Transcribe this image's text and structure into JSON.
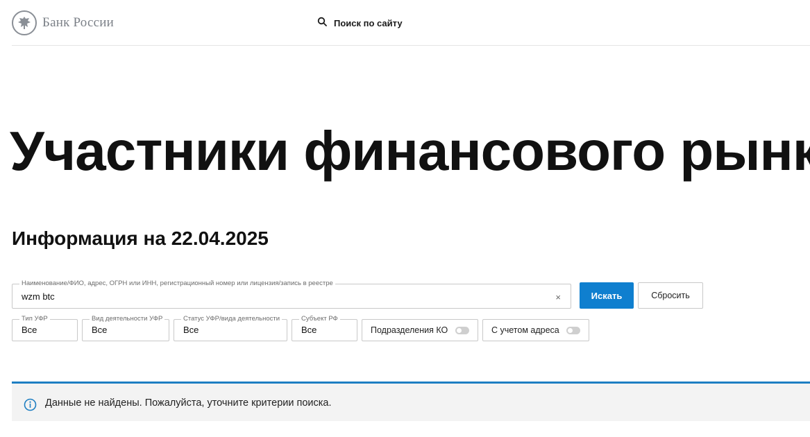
{
  "header": {
    "logo_text": "Банк России",
    "search_label": "Поиск по сайту"
  },
  "main": {
    "title": "Участники финансового рынка",
    "info_date": "Информация на 22.04.2025"
  },
  "search_form": {
    "query": {
      "label": "Наименование/ФИО, адрес, ОГРН или ИНН, регистрационный номер или лицензия/запись в реестре",
      "value": "wzm btc",
      "clear": "×"
    },
    "search_button": "Искать",
    "reset_button": "Сбросить",
    "filters": [
      {
        "label": "Тип УФР",
        "value": "Все"
      },
      {
        "label": "Вид деятельности УФР",
        "value": "Все"
      },
      {
        "label": "Статус УФР/вида деятельности",
        "value": "Все"
      },
      {
        "label": "Субъект РФ",
        "value": "Все"
      }
    ],
    "toggles": [
      {
        "label": "Подразделения КО",
        "on": false
      },
      {
        "label": "С учетом адреса",
        "on": false
      }
    ]
  },
  "notice": {
    "text": "Данные не найдены. Пожалуйста, уточните критерии поиска."
  },
  "colors": {
    "accent": "#0f7fcf",
    "notice_border": "#1e7ec2",
    "notice_bg": "#f3f3f3"
  }
}
